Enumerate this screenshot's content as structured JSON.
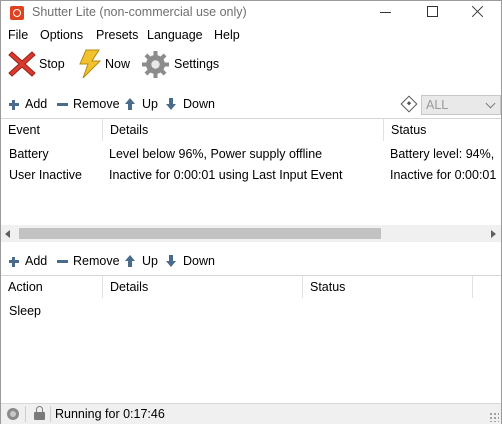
{
  "window": {
    "title": "Shutter Lite (non-commercial use only)"
  },
  "menu": [
    "File",
    "Options",
    "Presets",
    "Language",
    "Help"
  ],
  "toolbar": {
    "stop": "Stop",
    "now": "Now",
    "settings": "Settings"
  },
  "events_bar": {
    "add": "Add",
    "remove": "Remove",
    "up": "Up",
    "down": "Down",
    "filter_value": "ALL"
  },
  "events": {
    "columns": [
      "Event",
      "Details",
      "Status"
    ],
    "rows": [
      {
        "event": "Battery",
        "details": "Level below 96%, Power supply offline",
        "status": "Battery level: 94%,"
      },
      {
        "event": "User Inactive",
        "details": "Inactive for 0:00:01 using Last Input Event",
        "status": "Inactive for 0:00:01"
      }
    ]
  },
  "actions_bar": {
    "add": "Add",
    "remove": "Remove",
    "up": "Up",
    "down": "Down"
  },
  "actions": {
    "columns": [
      "Action",
      "Details",
      "Status"
    ],
    "rows": [
      {
        "action": "Sleep",
        "details": "",
        "status": ""
      }
    ]
  },
  "status": {
    "text": "Running for 0:17:46"
  },
  "colors": {
    "accent_icon": "#4a6b8a",
    "stop_red": "#d83a2f",
    "bolt_yellow": "#f2c12e"
  }
}
